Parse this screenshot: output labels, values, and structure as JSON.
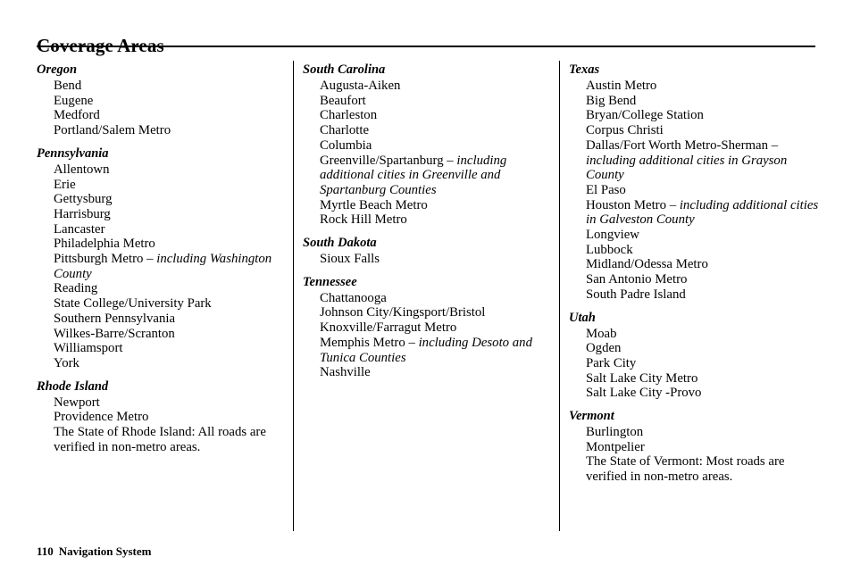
{
  "document": {
    "title": "Coverage Areas",
    "footer": {
      "page_number": "110",
      "label": "Navigation System"
    }
  },
  "columns": [
    {
      "id": "column-1",
      "states": [
        {
          "name": "Oregon",
          "cities": [
            {
              "main": "Bend",
              "note": ""
            },
            {
              "main": "Eugene",
              "note": ""
            },
            {
              "main": "Medford",
              "note": ""
            },
            {
              "main": "Portland/Salem Metro",
              "note": ""
            }
          ]
        },
        {
          "name": "Pennsylvania",
          "cities": [
            {
              "main": "Allentown",
              "note": ""
            },
            {
              "main": "Erie",
              "note": ""
            },
            {
              "main": "Gettysburg",
              "note": ""
            },
            {
              "main": "Harrisburg",
              "note": ""
            },
            {
              "main": "Lancaster",
              "note": ""
            },
            {
              "main": "Philadelphia Metro",
              "note": ""
            },
            {
              "main": "Pittsburgh Metro – ",
              "note": "including Washington County"
            },
            {
              "main": "Reading",
              "note": ""
            },
            {
              "main": "State College/University Park",
              "note": ""
            },
            {
              "main": "Southern Pennsylvania",
              "note": ""
            },
            {
              "main": "Wilkes-Barre/Scranton",
              "note": ""
            },
            {
              "main": "Williamsport",
              "note": ""
            },
            {
              "main": "York",
              "note": ""
            }
          ]
        },
        {
          "name": "Rhode Island",
          "cities": [
            {
              "main": "Newport",
              "note": ""
            },
            {
              "main": "Providence Metro",
              "note": ""
            },
            {
              "main": "The State of Rhode Island: All roads are verified in non-metro areas.",
              "note": ""
            }
          ]
        }
      ]
    },
    {
      "id": "column-2",
      "states": [
        {
          "name": "South Carolina",
          "cities": [
            {
              "main": "Augusta-Aiken",
              "note": ""
            },
            {
              "main": "Beaufort",
              "note": ""
            },
            {
              "main": "Charleston",
              "note": ""
            },
            {
              "main": "Charlotte",
              "note": ""
            },
            {
              "main": "Columbia",
              "note": ""
            },
            {
              "main": "Greenville/Spartanburg – ",
              "note": "including additional cities in Greenville and Spartanburg Counties"
            },
            {
              "main": "Myrtle Beach Metro",
              "note": ""
            },
            {
              "main": "Rock Hill Metro",
              "note": ""
            }
          ]
        },
        {
          "name": "South Dakota",
          "cities": [
            {
              "main": "Sioux Falls",
              "note": ""
            }
          ]
        },
        {
          "name": "Tennessee",
          "cities": [
            {
              "main": "Chattanooga",
              "note": ""
            },
            {
              "main": "Johnson City/Kingsport/Bristol",
              "note": ""
            },
            {
              "main": "Knoxville/Farragut Metro",
              "note": ""
            },
            {
              "main": "Memphis Metro – ",
              "note": "including Desoto and Tunica Counties"
            },
            {
              "main": "Nashville",
              "note": ""
            }
          ]
        }
      ]
    },
    {
      "id": "column-3",
      "states": [
        {
          "name": "Texas",
          "cities": [
            {
              "main": "Austin Metro",
              "note": ""
            },
            {
              "main": "Big Bend",
              "note": ""
            },
            {
              "main": "Bryan/College Station",
              "note": ""
            },
            {
              "main": "Corpus Christi",
              "note": ""
            },
            {
              "main": "Dallas/Fort Worth Metro-Sherman – ",
              "note": "including additional cities in Grayson County"
            },
            {
              "main": "El Paso",
              "note": ""
            },
            {
              "main": "Houston Metro – ",
              "note": "including additional cities in Galveston County"
            },
            {
              "main": "Longview",
              "note": ""
            },
            {
              "main": "Lubbock",
              "note": ""
            },
            {
              "main": "Midland/Odessa Metro",
              "note": ""
            },
            {
              "main": "San Antonio Metro",
              "note": ""
            },
            {
              "main": "South Padre Island",
              "note": ""
            }
          ]
        },
        {
          "name": "Utah",
          "cities": [
            {
              "main": "Moab",
              "note": ""
            },
            {
              "main": "Ogden",
              "note": ""
            },
            {
              "main": "Park City",
              "note": ""
            },
            {
              "main": "Salt Lake City Metro",
              "note": ""
            },
            {
              "main": "Salt Lake City -Provo",
              "note": ""
            }
          ]
        },
        {
          "name": "Vermont",
          "cities": [
            {
              "main": "Burlington",
              "note": ""
            },
            {
              "main": "Montpelier",
              "note": ""
            },
            {
              "main": "The State of Vermont: Most roads are verified in non-metro areas.",
              "note": ""
            }
          ]
        }
      ]
    }
  ]
}
